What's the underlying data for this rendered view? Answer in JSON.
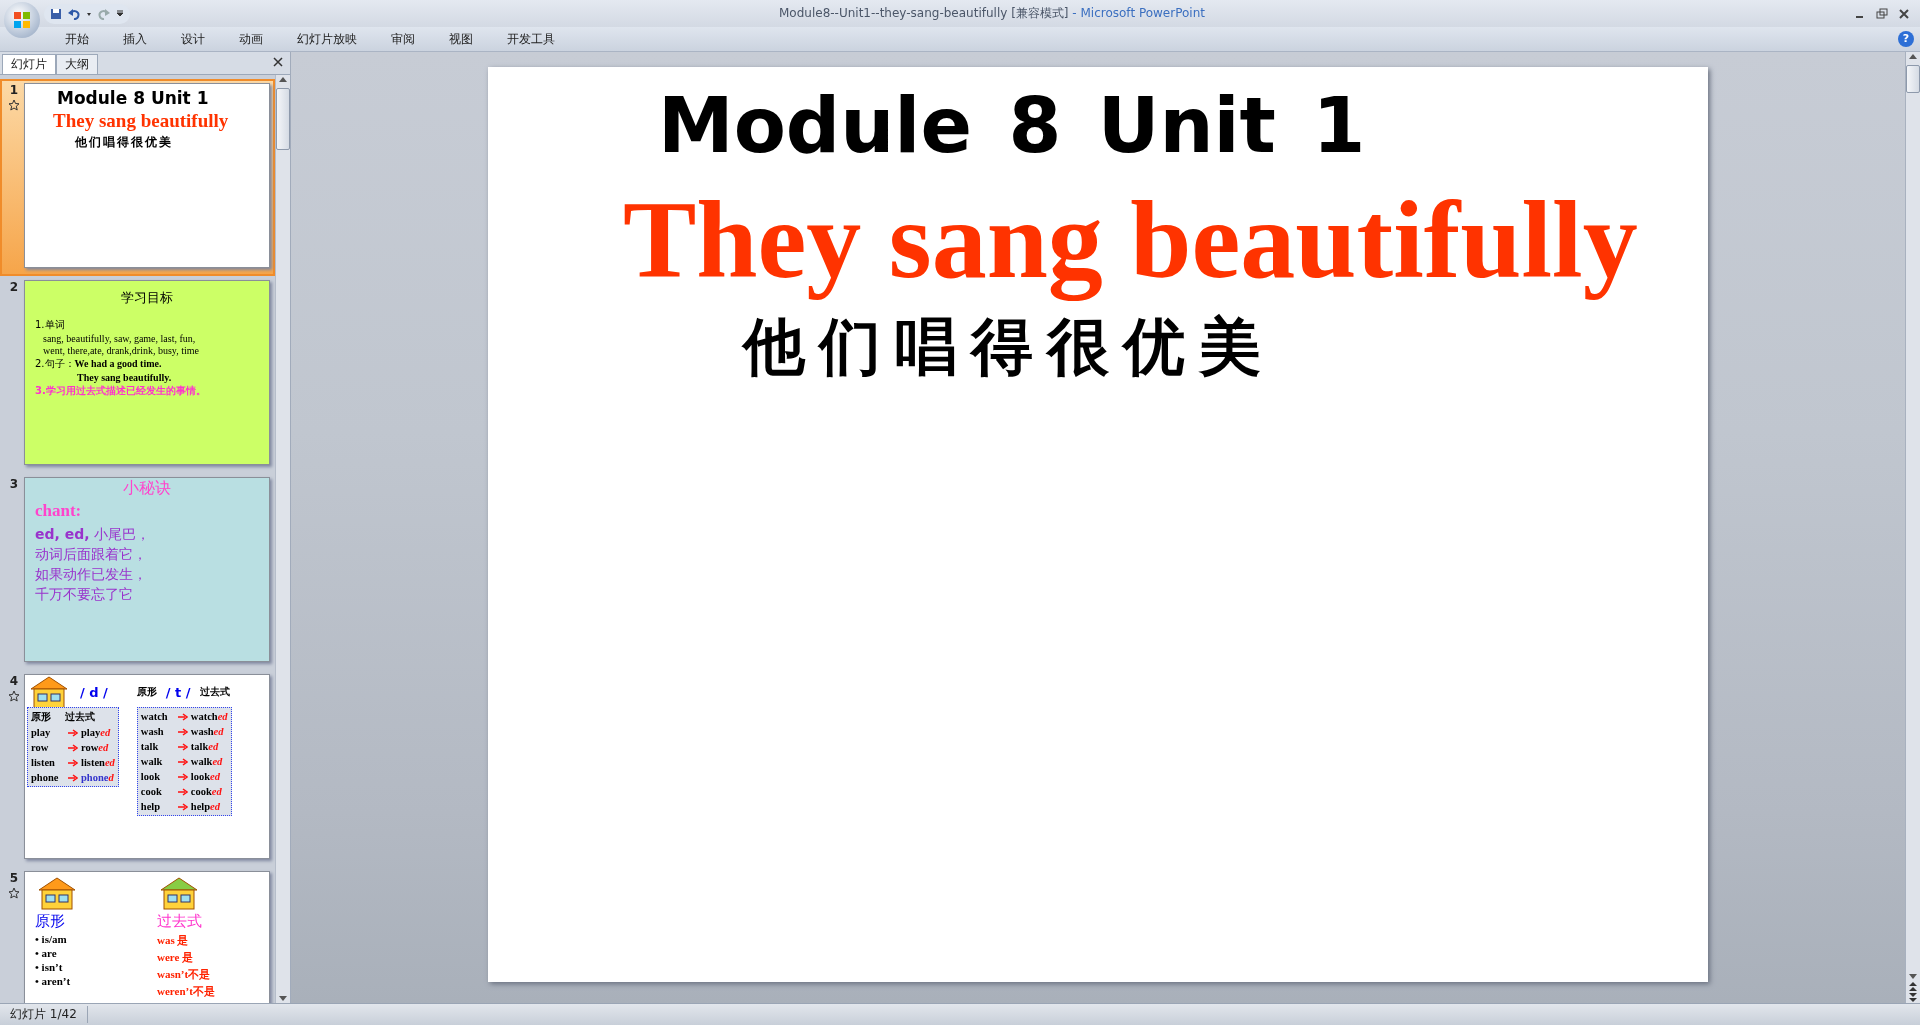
{
  "window": {
    "title": "Module8--Unit1--they-sang-beautifully [兼容模式]",
    "app_name": " - Microsoft PowerPoint"
  },
  "help_button": "?",
  "ribbon_tabs": [
    "开始",
    "插入",
    "设计",
    "动画",
    "幻灯片放映",
    "审阅",
    "视图",
    "开发工具"
  ],
  "pane_tabs": [
    {
      "label": "幻灯片",
      "selected": true
    },
    {
      "label": "大纲",
      "selected": false
    }
  ],
  "thumbnails": [
    {
      "number": "1",
      "selected": true,
      "animated": true,
      "kind": "title",
      "title": "Module 8 Unit 1",
      "subtitle": "They sang beautifully",
      "chinese": "他们唱得很优美"
    },
    {
      "number": "2",
      "selected": false,
      "animated": false,
      "kind": "objectives",
      "heading": "学习目标",
      "lines": [
        {
          "text": "1.单词",
          "kind": "plain"
        },
        {
          "text": "sang, beautifully,  saw, game, last, fun,",
          "kind": "words"
        },
        {
          "text": "went, there,ate,  drank,drink,  busy, time",
          "kind": "words"
        },
        {
          "text": "2.句子：**We had a good time.**",
          "kind": "plain"
        },
        {
          "text": "They sang beautifully.",
          "kind": "sentence"
        },
        {
          "text": "3.学习用过去式描述已经发生的事情。",
          "kind": "goal"
        }
      ]
    },
    {
      "number": "3",
      "selected": false,
      "animated": false,
      "kind": "chant",
      "heading": "小秘诀",
      "label": "chant:",
      "lines": [
        "**ed, ed,** 小尾巴，",
        "动词后面跟着它，",
        "如果动作已发生，",
        "千万不要忘了它"
      ]
    },
    {
      "number": "4",
      "selected": false,
      "animated": true,
      "kind": "word-lists",
      "left": {
        "sound": "/ d /",
        "base_header": "原形",
        "past_header": "过去式",
        "rows": [
          {
            "base": "play",
            "stem": "play",
            "ending": "ed",
            "color": "#000000"
          },
          {
            "base": "row",
            "stem": "row",
            "ending": "ed",
            "color": "#000000"
          },
          {
            "base": "listen",
            "stem": "listen",
            "ending": "ed",
            "color": "#000000"
          },
          {
            "base": "phone",
            "stem": "phone",
            "ending": "d",
            "color": "#3333cc"
          }
        ]
      },
      "right": {
        "sound": "/ t /",
        "base_header": "原形",
        "past_header": "过去式",
        "rows": [
          {
            "base": "watch",
            "stem": "watch",
            "ending": "ed",
            "color": "#000000"
          },
          {
            "base": "wash",
            "stem": "wash",
            "ending": "ed",
            "color": "#000000"
          },
          {
            "base": "talk",
            "stem": "talk",
            "ending": "ed",
            "color": "#000000"
          },
          {
            "base": "walk",
            "stem": "walk",
            "ending": "ed",
            "color": "#000000"
          },
          {
            "base": "look",
            "stem": "look",
            "ending": "ed",
            "color": "#000000"
          },
          {
            "base": "cook",
            "stem": "cook",
            "ending": "ed",
            "color": "#000000"
          },
          {
            "base": "help",
            "stem": "help",
            "ending": "ed",
            "color": "#000000"
          }
        ]
      }
    },
    {
      "number": "5",
      "selected": false,
      "animated": true,
      "kind": "houses",
      "left_label": "原形",
      "right_label": "过去式",
      "left_items": [
        "• is/am",
        "• are",
        "• isn’t",
        "• aren’t"
      ],
      "right_items": [
        "was 是",
        "were 是",
        "wasn’t不是",
        "weren’t不是"
      ]
    }
  ],
  "slide": {
    "title": "Module 8 Unit 1",
    "subtitle": "They sang beautifully",
    "chinese": "他们唱得很优美"
  },
  "status_bar": {
    "slide_counter": "幻灯片 1/42"
  }
}
